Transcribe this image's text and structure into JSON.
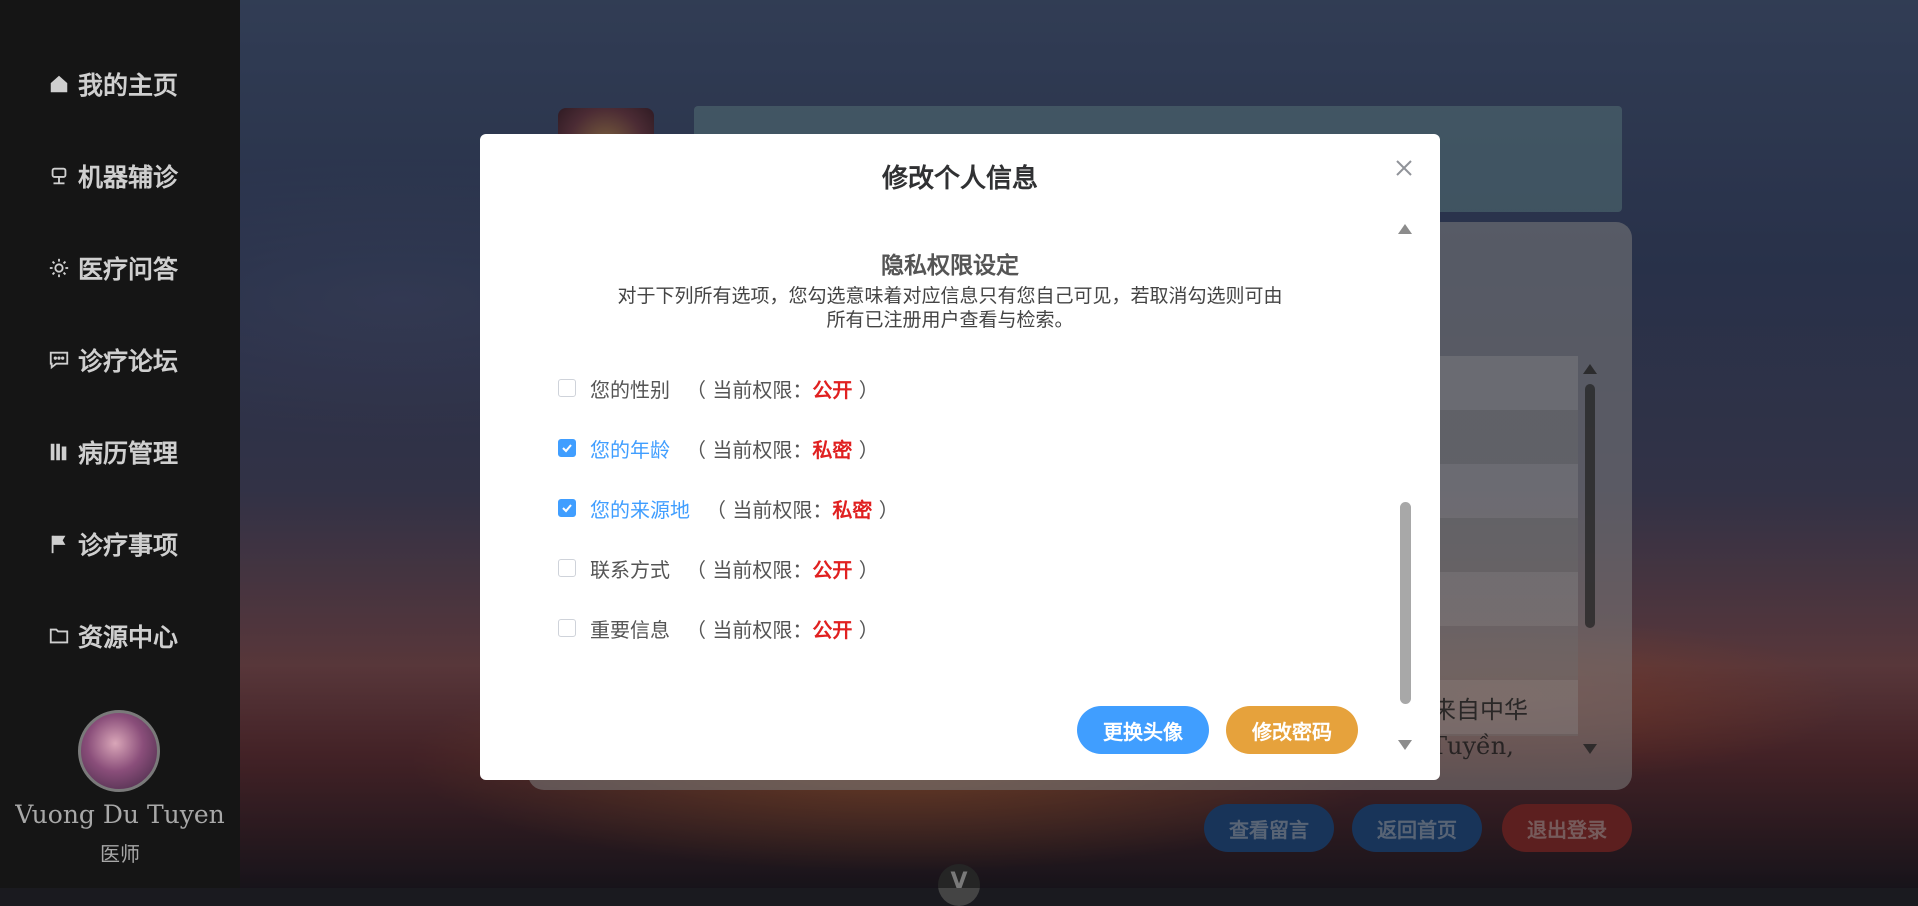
{
  "sidebar": {
    "items": [
      {
        "label": "我的主页",
        "icon": "home-icon"
      },
      {
        "label": "机器辅诊",
        "icon": "robot-icon"
      },
      {
        "label": "医疗问答",
        "icon": "sun-icon"
      },
      {
        "label": "诊疗论坛",
        "icon": "chat-icon"
      },
      {
        "label": "病历管理",
        "icon": "books-icon"
      },
      {
        "label": "诊疗事项",
        "icon": "flag-icon"
      },
      {
        "label": "资源中心",
        "icon": "folder-icon"
      }
    ],
    "user_name": "Vuong Du Tuyen",
    "user_role": "医师"
  },
  "main": {
    "card_text": "，来自中华\ng Tuyền,",
    "buttons": {
      "view_messages": "查看留言",
      "back_home": "返回首页",
      "logout": "退出登录"
    },
    "bottom_logo": "V"
  },
  "modal": {
    "title": "修改个人信息",
    "section_title": "隐私权限设定",
    "section_desc": "对于下列所有选项，您勾选意味着对应信息只有您自己可见，若取消勾选则可由所有已注册用户查看与检索。",
    "permission_prefix": "（ 当前权限：",
    "permission_suffix": " ）",
    "permissions": [
      {
        "label": "您的性别",
        "checked": false,
        "value": "公开"
      },
      {
        "label": "您的年龄",
        "checked": true,
        "value": "私密"
      },
      {
        "label": "您的来源地",
        "checked": true,
        "value": "私密"
      },
      {
        "label": "联系方式",
        "checked": false,
        "value": "公开"
      },
      {
        "label": "重要信息",
        "checked": false,
        "value": "公开"
      }
    ],
    "buttons": {
      "change_avatar": "更换头像",
      "change_password": "修改密码"
    }
  },
  "colors": {
    "primary": "#409eff",
    "warning": "#e6a23c",
    "danger_text": "#e02020",
    "sidebar_bg": "#2b2b2b"
  }
}
